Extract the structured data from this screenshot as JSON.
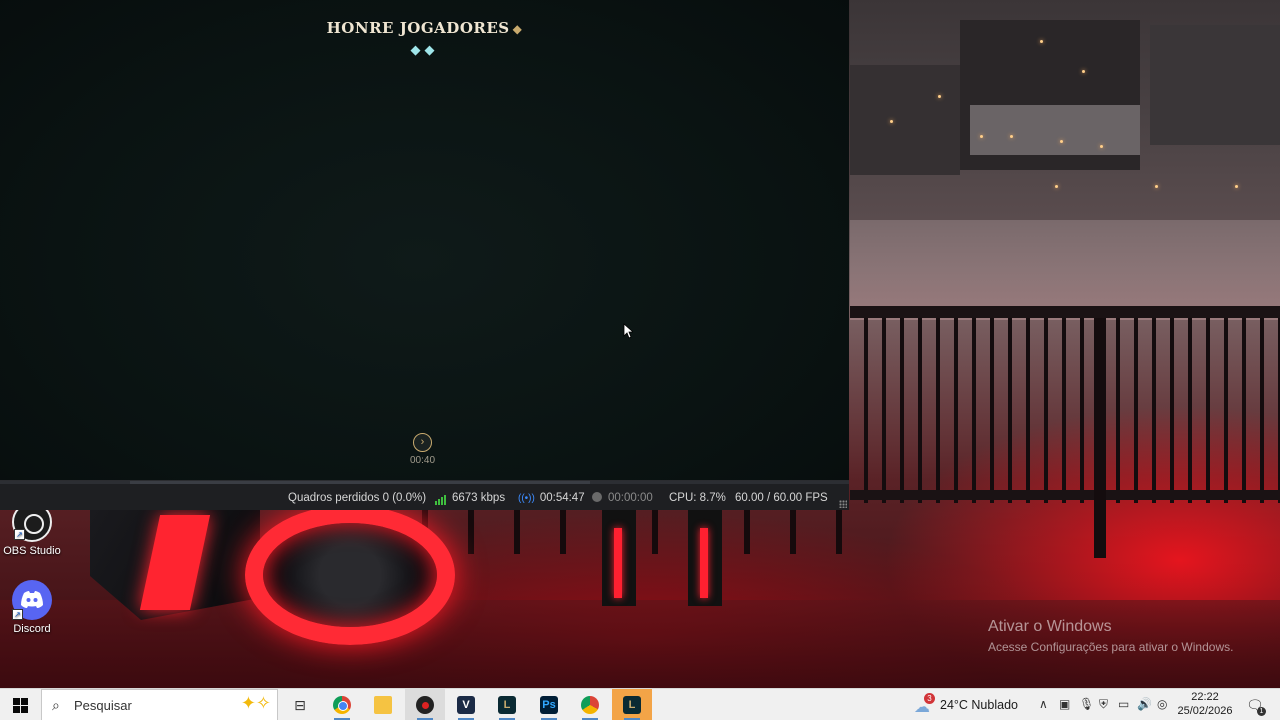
{
  "game": {
    "title": "HONRE JOGADORES",
    "title_gem": "◆",
    "gems": "◆◆",
    "next_icon": "chevron-right-icon",
    "timer": "00:40"
  },
  "obs_status": {
    "dropped_frames": "Quadros perdidos 0 (0.0%)",
    "bitrate": "6673 kbps",
    "stream_time": "00:54:47",
    "record_time": "00:00:00",
    "cpu": "CPU: 8.7%",
    "fps": "60.00 / 60.00 FPS"
  },
  "desktop": {
    "icons": [
      {
        "label": "OBS Studio",
        "icon": "obs-icon"
      },
      {
        "label": "Discord",
        "icon": "discord-icon"
      }
    ],
    "activate_title": "Ativar o Windows",
    "activate_subtitle": "Acesse Configurações para ativar o Windows."
  },
  "taskbar": {
    "search_placeholder": "Pesquisar",
    "apps": [
      {
        "name": "task-view",
        "glyph": "⊟"
      },
      {
        "name": "chrome",
        "glyph": ""
      },
      {
        "name": "file-explorer",
        "glyph": ""
      },
      {
        "name": "obs-studio",
        "glyph": ""
      },
      {
        "name": "vegas",
        "glyph": "V"
      },
      {
        "name": "league-client",
        "glyph": "L"
      },
      {
        "name": "photoshop",
        "glyph": "Ps"
      },
      {
        "name": "chrome-profile",
        "glyph": ""
      },
      {
        "name": "league-of-legends",
        "glyph": "L"
      }
    ],
    "weather": {
      "badge": "3",
      "text": "24°C  Nublado"
    },
    "time": "22:22",
    "date": "25/02/2026",
    "notifications_badge": "1"
  },
  "colors": {
    "gold": "#c8aa6e",
    "obs_bar": "#1e1f22",
    "taskbar": "#f0f0f0",
    "active_app": "#f3a447"
  }
}
